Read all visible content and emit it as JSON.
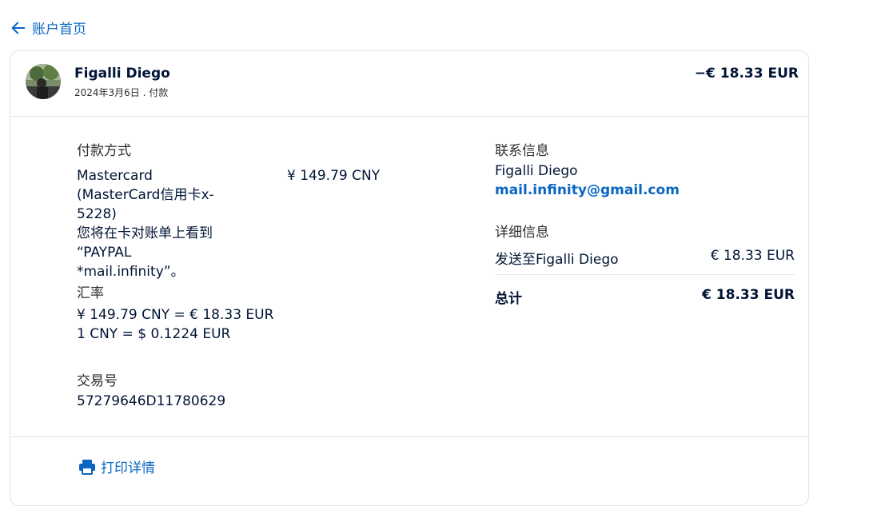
{
  "nav": {
    "back_label": "账户首页"
  },
  "transaction": {
    "payee_name": "Figalli Diego",
    "date_type": "2024年3月6日 . 付款",
    "amount": "−€ 18.33 EUR"
  },
  "payment_method": {
    "title": "付款方式",
    "card_lines": [
      "Mastercard",
      "(MasterCard信用卡x-",
      "5228)",
      "您将在卡对账单上看到",
      "“PAYPAL *mail.infinity”。"
    ],
    "amount": "¥ 149.79 CNY"
  },
  "exchange_rate": {
    "title": "汇率",
    "line1": "¥ 149.79 CNY = € 18.33 EUR",
    "line2": "1 CNY = $ 0.1224 EUR"
  },
  "transaction_id": {
    "title": "交易号",
    "value": "57279646D11780629"
  },
  "contact": {
    "title": "联系信息",
    "name": "Figalli Diego",
    "email": "mail.infinity@gmail.com"
  },
  "details": {
    "title": "详细信息",
    "ship_to_label": "发送至Figalli Diego",
    "ship_to_amount": "€ 18.33 EUR",
    "total_label": "总计",
    "total_amount": "€ 18.33 EUR"
  },
  "footer": {
    "print_label": "打印详情"
  },
  "colors": {
    "link": "#0a66c2",
    "text": "#001435",
    "border": "#e3e3e3"
  }
}
